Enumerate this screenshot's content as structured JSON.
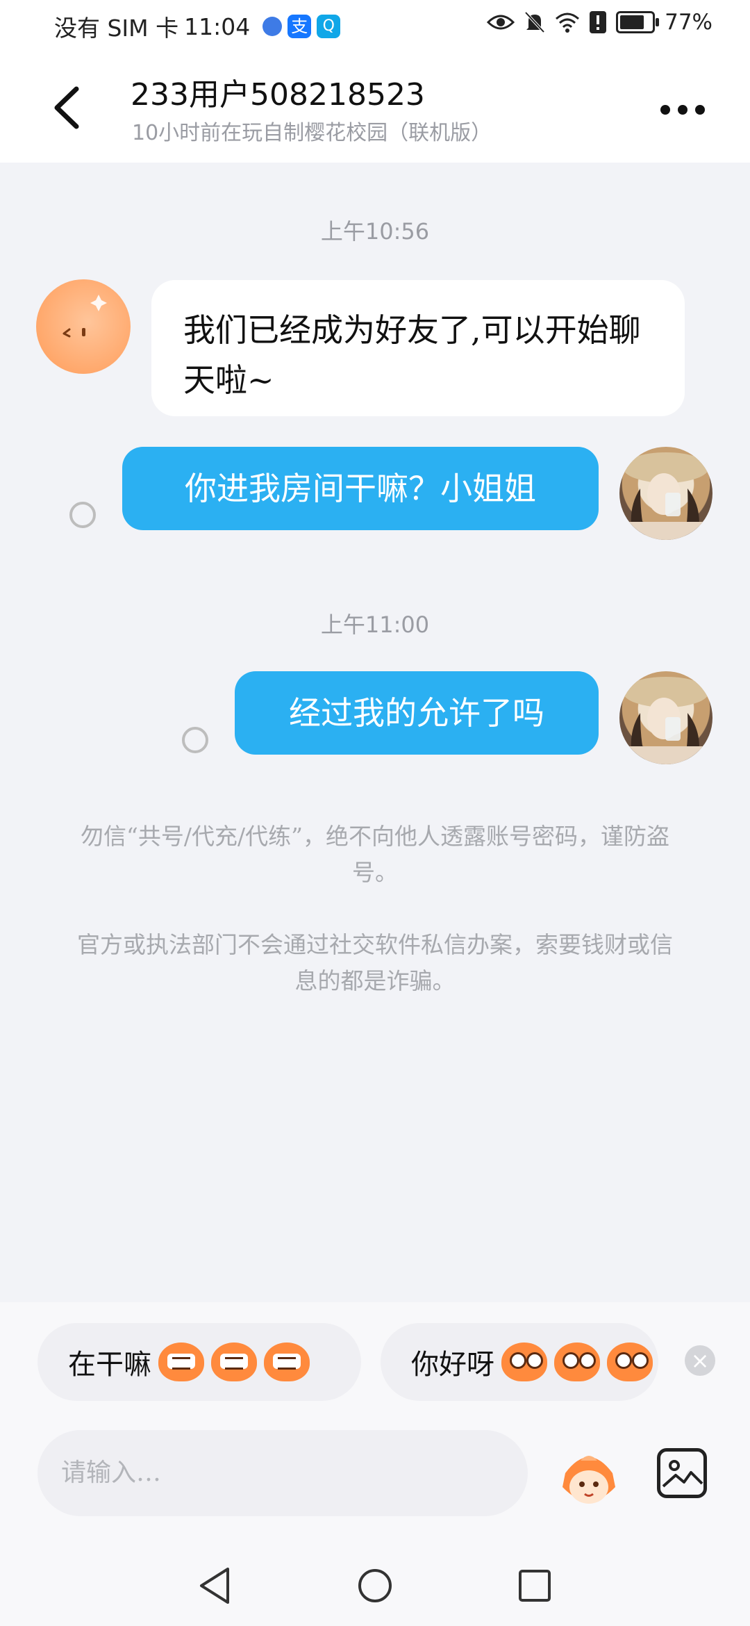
{
  "status_bar": {
    "carrier": "没有 SIM 卡",
    "time": "11:04",
    "alipay_glyph": "支",
    "search_glyph": "Q",
    "battery_percent": "77%",
    "battery_level": 0.77,
    "icons": [
      "globe-icon",
      "alipay-icon",
      "search-app-icon",
      "eye-icon",
      "bell-off-icon",
      "wifi-icon",
      "alert-icon",
      "battery-icon"
    ]
  },
  "header": {
    "title": "233用户508218523",
    "subtitle": "10小时前在玩自制樱花校园（联机版）"
  },
  "messages": {
    "time1": "上午10:56",
    "system_message": "我们已经成为好友了,可以开始聊天啦~",
    "msg1": "你进我房间干嘛？小姐姐",
    "time2": "上午11:00",
    "msg2": "经过我的允许了吗"
  },
  "notices": {
    "notice1": "勿信“共号/代充/代练”，绝不向他人透露账号密码，谨防盗号。",
    "notice2": "官方或执法部门不会通过社交软件私信办案，索要钱财或信息的都是诈骗。"
  },
  "quick_replies": {
    "chip1": "在干嘛",
    "chip2": "你好呀",
    "close_glyph": "×"
  },
  "input": {
    "placeholder": "请输入…"
  },
  "colors": {
    "accent_blue": "#2bb0f2",
    "background": "#f2f3f7"
  }
}
